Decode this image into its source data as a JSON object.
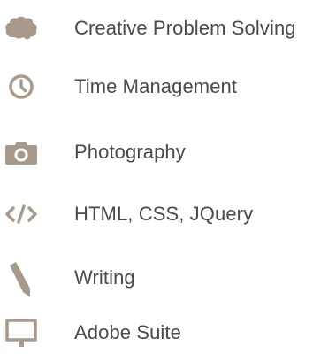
{
  "theme": {
    "icon_color": "#a89a8b",
    "text_color": "#4a4a4a"
  },
  "skills": [
    {
      "icon": "brain-icon",
      "label": "Creative Problem Solving"
    },
    {
      "icon": "clock-icon",
      "label": "Time Management"
    },
    {
      "icon": "camera-icon",
      "label": "Photography"
    },
    {
      "icon": "code-icon",
      "label": "HTML, CSS, JQuery"
    },
    {
      "icon": "pencil-icon",
      "label": "Writing"
    },
    {
      "icon": "monitor-icon",
      "label": "Adobe Suite"
    }
  ]
}
